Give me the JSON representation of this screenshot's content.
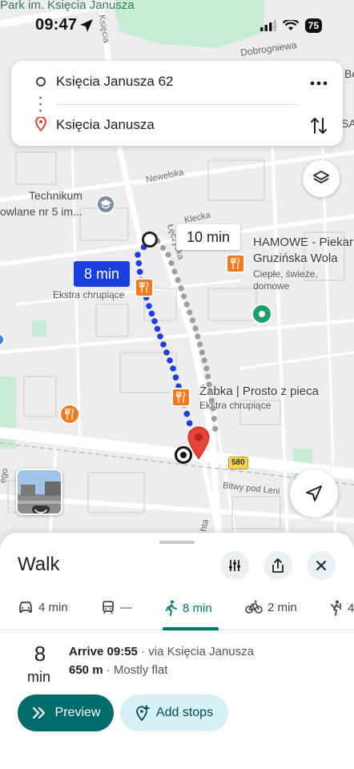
{
  "status_bar": {
    "time": "09:47",
    "battery": "75"
  },
  "search": {
    "origin": "Księcia Janusza 62",
    "destination": "Księcia Janusza"
  },
  "map": {
    "labels": {
      "park": "Park im. Księcia Janusza",
      "dobrogniewa": "Dobrogniewa",
      "newelska": "Newelska",
      "klecka": "Klecka",
      "leczycka": "Łęczycka",
      "technikum_1": "Technikum",
      "technikum_2": "owlane nr 5 im...",
      "ksiecia": "Księcia",
      "bitwy": "Bitwy pod Leni",
      "ekstra_left": "Ekstra chrupiące",
      "road_580": "580",
      "edge_bo": "Bo",
      "edge_sa": "SA",
      "edge_ego": "ego",
      "edge_hta": "hta"
    },
    "pois": [
      {
        "name": "HAMOWE - Piekarnia",
        "sub": "Gruzińska Wola",
        "desc1": "Ciepłe, świeże,",
        "desc2": "domowe"
      },
      {
        "name": "Żabka | Prosto z pieca",
        "sub": "Ekstra chrupiące"
      }
    ],
    "route_main_time": "8 min",
    "route_alt_time": "10 min"
  },
  "sheet": {
    "title": "Walk",
    "modes": [
      {
        "icon": "car-icon",
        "label": "4 min"
      },
      {
        "icon": "transit-icon",
        "label": "—"
      },
      {
        "icon": "walk-icon",
        "label": "8 min"
      },
      {
        "icon": "bike-icon",
        "label": "2 min"
      },
      {
        "icon": "ride-icon",
        "label": "4"
      }
    ],
    "duration_value": "8",
    "duration_unit": "min",
    "arrive": "Arrive 09:55",
    "via": " · via Księcia Janusza",
    "distance": "650 m",
    "terrain": " · Mostly flat",
    "preview_label": "Preview",
    "add_stops_label": "Add stops"
  },
  "colors": {
    "route_main": "#1a3ee0",
    "route_alt": "#9e9e9e",
    "active_mode": "#00796b",
    "preview_bg": "#006b6b",
    "addstops_bg": "#d6f0f7",
    "poi_orange": "#f37a1f",
    "destination_pin": "#ea4335"
  }
}
